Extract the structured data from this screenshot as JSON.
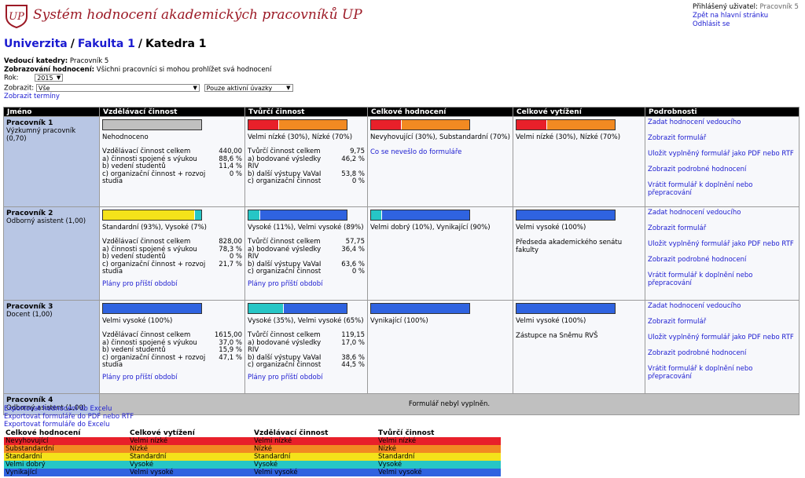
{
  "app": {
    "title": "Systém hodnocení akademických pracovníků UP",
    "user_label": "Přihlášený uživatel:",
    "user_name": "Pracovník 5",
    "link_home": "Zpět na hlavní stránku",
    "link_logout": "Odhlásit se"
  },
  "breadcrumb": {
    "univerzita": "Univerzita",
    "fakulta": "Fakulta 1",
    "katedra": "Katedra 1",
    "sep": "/"
  },
  "info": {
    "head_label": "Vedoucí katedry:",
    "head_value": "Pracovník 5",
    "display_label": "Zobrazování hodnocení:",
    "display_value": "Všichni pracovníci si mohou prohlížet svá hodnocení"
  },
  "controls": {
    "year_label": "Rok:",
    "year_value": "2015",
    "show_label": "Zobrazit:",
    "show_value": "Vše",
    "filter_value": "Pouze aktivní úvazky",
    "terms_link": "Zobrazit termíny"
  },
  "table": {
    "headers": [
      "Jméno",
      "Vzdělávací činnost",
      "Tvůrčí činnost",
      "Celkové hodnocení",
      "Celkové vytížení",
      "Podrobnosti"
    ],
    "rows": [
      {
        "name": "Pracovník 1",
        "role": "Výzkumný pracovník (0,70)",
        "edu": {
          "caption": "Nehodnoceno",
          "stats": [
            [
              "Vzdělávací činnost celkem",
              "440,00"
            ],
            [
              "a) činnosti spojené s výukou",
              "88,6 %"
            ],
            [
              "b) vedení studentů",
              "11,4 %"
            ],
            [
              "c) organizační činnost + rozvoj studia",
              "0 %"
            ]
          ],
          "plan": ""
        },
        "cre": {
          "caption": "Velmi nízké (30%), Nízké (70%)",
          "stats": [
            [
              "Tvůrčí činnost celkem",
              "9,75"
            ],
            [
              "a) bodované výsledky RIV",
              "46,2 %"
            ],
            [
              "b) další výstupy VaVaI",
              "53,8 %"
            ],
            [
              "c) organizační činnost",
              "0 %"
            ]
          ],
          "plan": ""
        },
        "total": {
          "caption": "Nevyhovující (30%), Substandardní (70%)",
          "note": "Co se nevešlo do formuláře"
        },
        "load": {
          "caption": "Velmi nízké (30%), Nízké (70%)",
          "note": ""
        },
        "links": [
          "Zadat hodnocení vedoucího",
          "Zobrazit formulář",
          "Uložit vyplněný formulář jako PDF nebo RTF",
          "Zobrazit podrobné hodnocení",
          "Vrátit formulář k doplnění nebo přepracování"
        ]
      },
      {
        "name": "Pracovník 2",
        "role": "Odborný asistent (1,00)",
        "edu": {
          "caption": "Standardní (93%), Vysoké (7%)",
          "stats": [
            [
              "Vzdělávací činnost celkem",
              "828,00"
            ],
            [
              "a) činnosti spojené s výukou",
              "78,3 %"
            ],
            [
              "b) vedení studentů",
              "0 %"
            ],
            [
              "c) organizační činnost + rozvoj studia",
              "21,7 %"
            ]
          ],
          "plan": "Plány pro příští období"
        },
        "cre": {
          "caption": "Vysoké (11%), Velmi vysoké (89%)",
          "stats": [
            [
              "Tvůrčí činnost celkem",
              "57,75"
            ],
            [
              "a) bodované výsledky RIV",
              "36,4 %"
            ],
            [
              "b) další výstupy VaVaI",
              "63,6 %"
            ],
            [
              "c) organizační činnost",
              "0 %"
            ]
          ],
          "plan": "Plány pro příští období"
        },
        "total": {
          "caption": "Velmi dobrý (10%), Vynikající (90%)",
          "note": ""
        },
        "load": {
          "caption": "Velmi vysoké (100%)",
          "note": "Předseda akademického senátu fakulty"
        },
        "links": [
          "Zadat hodnocení vedoucího",
          "Zobrazit formulář",
          "Uložit vyplněný formulář jako PDF nebo RTF",
          "Zobrazit podrobné hodnocení",
          "Vrátit formulář k doplnění nebo přepracování"
        ]
      },
      {
        "name": "Pracovník 3",
        "role": "Docent (1,00)",
        "edu": {
          "caption": "Velmi vysoké (100%)",
          "stats": [
            [
              "Vzdělávací činnost celkem",
              "1615,00"
            ],
            [
              "a) činnosti spojené s výukou",
              "37,0 %"
            ],
            [
              "b) vedení studentů",
              "15,9 %"
            ],
            [
              "c) organizační činnost + rozvoj studia",
              "47,1 %"
            ]
          ],
          "plan": "Plány pro příští období"
        },
        "cre": {
          "caption": "Vysoké (35%), Velmi vysoké (65%)",
          "stats": [
            [
              "Tvůrčí činnost celkem",
              "119,15"
            ],
            [
              "a) bodované výsledky RIV",
              "17,0 %"
            ],
            [
              "b) další výstupy VaVaI",
              "38,6 %"
            ],
            [
              "c) organizační činnost",
              "44,5 %"
            ]
          ],
          "plan": "Plány pro příští období"
        },
        "total": {
          "caption": "Vynikající (100%)",
          "note": ""
        },
        "load": {
          "caption": "Velmi vysoké (100%)",
          "note": "Zástupce na Sněmu RVŠ"
        },
        "links": [
          "Zadat hodnocení vedoucího",
          "Zobrazit formulář",
          "Uložit vyplněný formulář jako PDF nebo RTF",
          "Zobrazit podrobné hodnocení",
          "Vrátit formulář k doplnění nebo přepracování"
        ]
      }
    ],
    "row4": {
      "name": "Pracovník 4",
      "role": "Odborný asistent (1,00)",
      "message": "Formulář nebyl vyplněn."
    }
  },
  "bars": {
    "r1_edu": [
      {
        "c": "#c0c0c0",
        "p": 1.0
      }
    ],
    "r1_cre": [
      {
        "c": "#e8202a",
        "p": 0.3
      },
      {
        "c": "#f28a22",
        "p": 0.7
      }
    ],
    "r1_total": [
      {
        "c": "#e8202a",
        "p": 0.3
      },
      {
        "c": "#f28a22",
        "p": 0.7
      }
    ],
    "r1_load": [
      {
        "c": "#e8202a",
        "p": 0.3
      },
      {
        "c": "#f28a22",
        "p": 0.7
      }
    ],
    "r2_edu": [
      {
        "c": "#f4e21a",
        "p": 0.93
      },
      {
        "c": "#26c6c6",
        "p": 0.07
      }
    ],
    "r2_cre": [
      {
        "c": "#26c6c6",
        "p": 0.11
      },
      {
        "c": "#2f63e0",
        "p": 0.89
      }
    ],
    "r2_total": [
      {
        "c": "#26c6c6",
        "p": 0.1
      },
      {
        "c": "#2f63e0",
        "p": 0.9
      }
    ],
    "r2_load": [
      {
        "c": "#2f63e0",
        "p": 1.0
      }
    ],
    "r3_edu": [
      {
        "c": "#2f63e0",
        "p": 1.0
      }
    ],
    "r3_cre": [
      {
        "c": "#26c6c6",
        "p": 0.35
      },
      {
        "c": "#2f63e0",
        "p": 0.65
      }
    ],
    "r3_total": [
      {
        "c": "#2f63e0",
        "p": 1.0
      }
    ],
    "r3_load": [
      {
        "c": "#2f63e0",
        "p": 1.0
      }
    ]
  },
  "exports": [
    "Exportovat hodnocení do Excelu",
    "Exportovat formuláře do PDF nebo RTF",
    "Exportovat formuláře do Excelu"
  ],
  "legend": {
    "headers": [
      "Celkové hodnocení",
      "Celkové vytížení",
      "Vzdělávací činnost",
      "Tvůrčí činnost"
    ],
    "colors": [
      "#e8202a",
      "#f28a22",
      "#f4e21a",
      "#26c6c6",
      "#2f63e0"
    ],
    "rows": [
      [
        "Nevyhovující",
        "Velmi nízké",
        "Velmi nízké",
        "Velmi nízké"
      ],
      [
        "Substandardní",
        "Nízké",
        "Nízké",
        "Nízké"
      ],
      [
        "Standardní",
        "Standardní",
        "Standardní",
        "Standardní"
      ],
      [
        "Velmi dobrý",
        "Vysoké",
        "Vysoké",
        "Vysoké"
      ],
      [
        "Vynikající",
        "Velmi vysoké",
        "Velmi vysoké",
        "Velmi vysoké"
      ]
    ]
  }
}
